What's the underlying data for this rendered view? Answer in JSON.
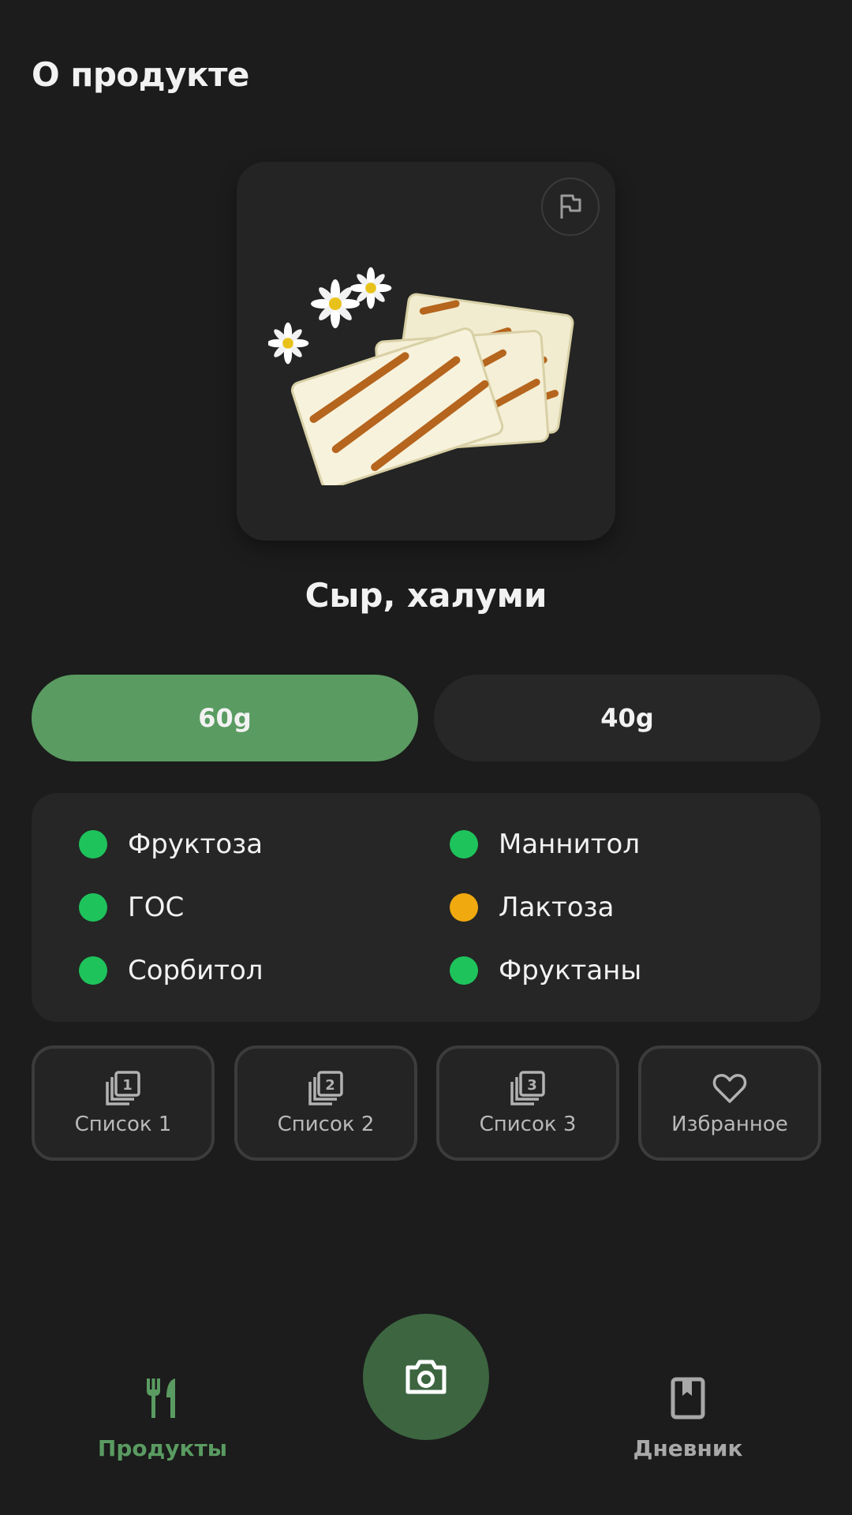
{
  "header": {
    "title": "О продукте"
  },
  "product": {
    "name": "Сыр, халуми"
  },
  "portions": [
    {
      "label": "60g",
      "selected": true
    },
    {
      "label": "40g",
      "selected": false
    }
  ],
  "fodmaps": [
    {
      "label": "Фруктоза",
      "status_color": "#1ec35c"
    },
    {
      "label": "Маннитол",
      "status_color": "#1ec35c"
    },
    {
      "label": "ГОС",
      "status_color": "#1ec35c"
    },
    {
      "label": "Лактоза",
      "status_color": "#f0a90e"
    },
    {
      "label": "Сорбитол",
      "status_color": "#1ec35c"
    },
    {
      "label": "Фруктаны",
      "status_color": "#1ec35c"
    }
  ],
  "lists": [
    {
      "label": "Список 1",
      "icon": "list-1-icon"
    },
    {
      "label": "Список 2",
      "icon": "list-2-icon"
    },
    {
      "label": "Список 3",
      "icon": "list-3-icon"
    },
    {
      "label": "Избранное",
      "icon": "heart-icon"
    }
  ],
  "nav": {
    "products_label": "Продукты",
    "diary_label": "Дневник",
    "active_color": "#5a9b61",
    "inactive_color": "#a8a8a8"
  }
}
